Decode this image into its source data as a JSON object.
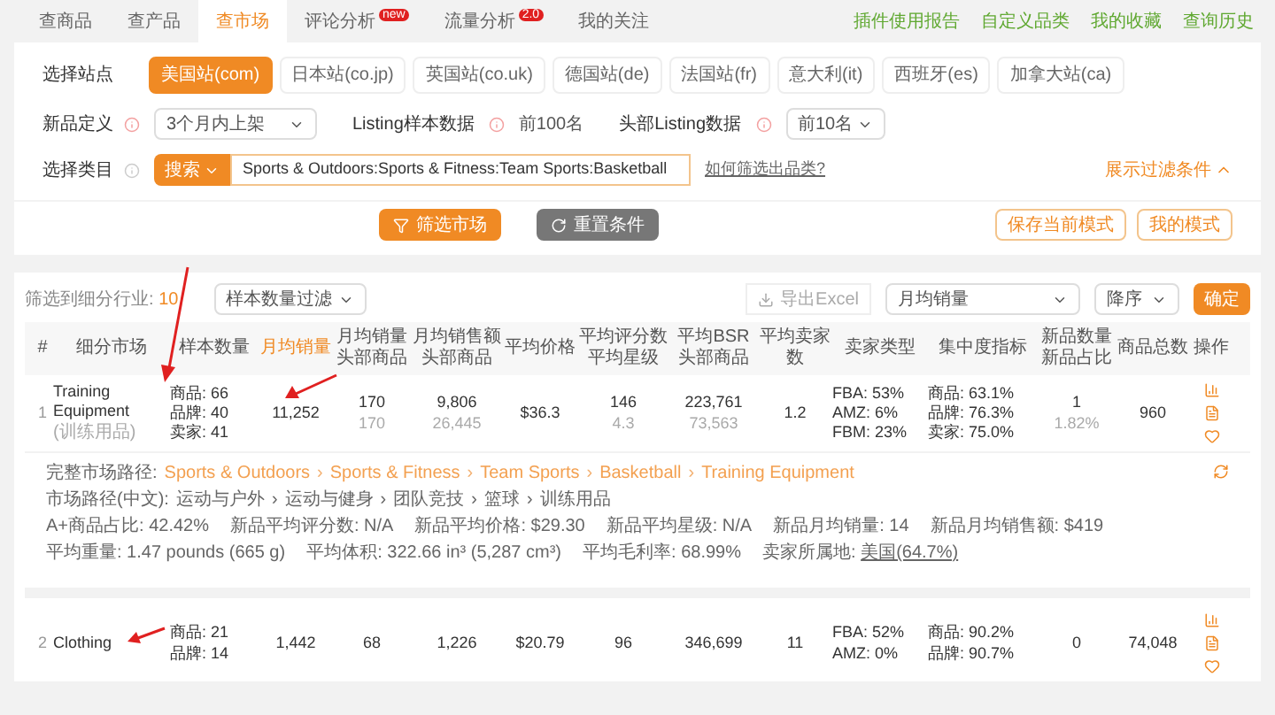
{
  "tabs": [
    {
      "label": "查商品",
      "selected": false
    },
    {
      "label": "查产品",
      "selected": false
    },
    {
      "label": "查市场",
      "selected": true
    },
    {
      "label": "评论分析",
      "badge": "new",
      "selected": false
    },
    {
      "label": "流量分析",
      "badge": "2.0",
      "selected": false
    },
    {
      "label": "我的关注",
      "selected": false
    }
  ],
  "top_links": [
    "插件使用报告",
    "自定义品类",
    "我的收藏",
    "查询历史"
  ],
  "filters": {
    "site_label": "选择站点",
    "sites": [
      {
        "label": "美国站(com)",
        "selected": true
      },
      {
        "label": "日本站(co.jp)",
        "selected": false
      },
      {
        "label": "英国站(co.uk)",
        "selected": false
      },
      {
        "label": "德国站(de)",
        "selected": false
      },
      {
        "label": "法国站(fr)",
        "selected": false
      },
      {
        "label": "意大利(it)",
        "selected": false
      },
      {
        "label": "西班牙(es)",
        "selected": false
      },
      {
        "label": "加拿大站(ca)",
        "selected": false
      }
    ],
    "new_def": {
      "label": "新品定义",
      "value": "3个月内上架"
    },
    "sample": {
      "label": "Listing样本数据",
      "value": "前100名"
    },
    "head": {
      "label": "头部Listing数据",
      "value": "前10名"
    },
    "category": {
      "label": "选择类目",
      "mode": "搜索",
      "value": "Sports & Outdoors:Sports & Fitness:Team Sports:Basketball",
      "help": "如何筛选出品类?"
    },
    "toggle": "展示过滤条件"
  },
  "actions": {
    "filter": "筛选市场",
    "reset": "重置条件",
    "save": "保存当前模式",
    "mine": "我的模式"
  },
  "toolbar": {
    "count_label": "筛选到细分行业:",
    "count": "10",
    "sample_filter": "样本数量过滤",
    "export": "导出Excel",
    "sort_by": "月均销量",
    "order": "降序",
    "confirm": "确定"
  },
  "columns": [
    {
      "label": "#",
      "sorted": false
    },
    {
      "label": "细分市场",
      "sorted": false
    },
    {
      "label": "样本数量",
      "sorted": false
    },
    {
      "label": "月均销量",
      "sorted": true
    },
    {
      "label": "月均销量头部商品",
      "sorted": false
    },
    {
      "label": "月均销售额头部商品",
      "sorted": false
    },
    {
      "label": "平均价格",
      "sorted": false
    },
    {
      "label": "平均评分数平均星级",
      "sorted": false
    },
    {
      "label": "平均BSR头部商品",
      "sorted": false
    },
    {
      "label": "平均卖家数",
      "sorted": false
    },
    {
      "label": "卖家类型",
      "sorted": false
    },
    {
      "label": "集中度指标",
      "sorted": false
    },
    {
      "label": "新品数量新品占比",
      "sorted": false
    },
    {
      "label": "商品总数",
      "sorted": false
    },
    {
      "label": "操作",
      "sorted": false
    }
  ],
  "rows": [
    {
      "index": "1",
      "niche": "Training Equipment",
      "niche_cn": "(训练用品)",
      "samples": [
        "商品: 66",
        "品牌: 40",
        "卖家: 41"
      ],
      "sales": "11,252",
      "head_sales": [
        "170",
        "170"
      ],
      "revenue": [
        "9,806",
        "26,445"
      ],
      "price": "$36.3",
      "rating": [
        "146",
        "4.3"
      ],
      "bsr": [
        "223,761",
        "73,563"
      ],
      "sellers": "1.2",
      "seller_types": [
        "FBA: 53%",
        "AMZ: 6%",
        "FBM: 23%"
      ],
      "concentration": [
        "商品: 63.1%",
        "品牌: 76.3%",
        "卖家: 75.0%"
      ],
      "new": [
        "1",
        "1.82%"
      ],
      "total": "960",
      "detail": {
        "separator": "›",
        "path_label": "完整市场路径:",
        "path": [
          "Sports & Outdoors",
          "Sports & Fitness",
          "Team Sports",
          "Basketball",
          "Training Equipment"
        ],
        "path_cn_label": "市场路径(中文):",
        "path_cn": [
          "运动与户外",
          "运动与健身",
          "团队竞技",
          "篮球",
          "训练用品"
        ],
        "stats1": [
          "A+商品占比: 42.42%",
          "新品平均评分数: N/A",
          "新品平均价格: $29.30",
          "新品平均星级: N/A",
          "新品月均销量: 14",
          "新品月均销售额: $419"
        ],
        "stats2": [
          "平均重量: 1.47 pounds (665 g)",
          "平均体积: 322.66 in³ (5,287 cm³)",
          "平均毛利率: 68.99%"
        ],
        "origin_label": "卖家所属地:",
        "origin": "美国(64.7%)"
      }
    },
    {
      "index": "2",
      "niche": "Clothing",
      "samples": [
        "商品: 21",
        "品牌: 14"
      ],
      "sales": "1,442",
      "head_sales": [
        "68"
      ],
      "revenue": [
        "1,226"
      ],
      "price": "$20.79",
      "rating": [
        "96"
      ],
      "bsr": [
        "346,699"
      ],
      "sellers": "11",
      "seller_types": [
        "FBA: 52%",
        "AMZ: 0%"
      ],
      "concentration": [
        "商品: 90.2%",
        "品牌: 90.7%"
      ],
      "new": [
        "0"
      ],
      "total": "74,048"
    }
  ]
}
